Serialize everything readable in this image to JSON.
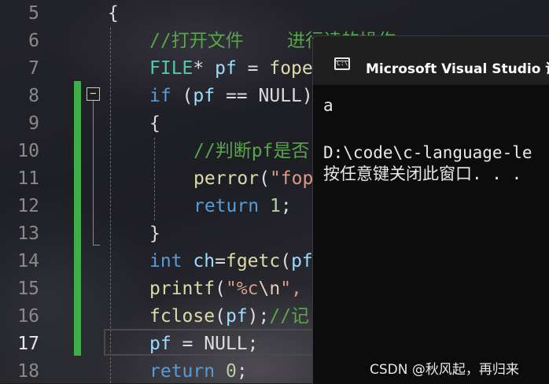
{
  "editor": {
    "line_numbers": [
      "5",
      "6",
      "7",
      "8",
      "9",
      "10",
      "11",
      "12",
      "13",
      "14",
      "15",
      "16",
      "17",
      "18"
    ],
    "lines": [
      {
        "num": "5",
        "parts": [
          {
            "t": "{",
            "c": ""
          }
        ]
      },
      {
        "num": "6",
        "parts": [
          {
            "t": "//打开文件    进行读的操作",
            "c": "cm"
          }
        ]
      },
      {
        "num": "7",
        "parts": [
          {
            "t": "FILE",
            "c": "tp"
          },
          {
            "t": "* ",
            "c": ""
          },
          {
            "t": "pf",
            "c": "id"
          },
          {
            "t": " = ",
            "c": ""
          },
          {
            "t": "fopen",
            "c": "fn"
          }
        ]
      },
      {
        "num": "8",
        "parts": [
          {
            "t": "if",
            "c": "kw"
          },
          {
            "t": " (",
            "c": ""
          },
          {
            "t": "pf",
            "c": "id"
          },
          {
            "t": " == NULL)",
            "c": ""
          }
        ]
      },
      {
        "num": "9",
        "parts": [
          {
            "t": "{",
            "c": ""
          }
        ]
      },
      {
        "num": "10",
        "parts": [
          {
            "t": "//判断pf是否",
            "c": "cm"
          }
        ]
      },
      {
        "num": "11",
        "parts": [
          {
            "t": "perror",
            "c": "fn"
          },
          {
            "t": "(",
            "c": ""
          },
          {
            "t": "\"fopen",
            "c": "str"
          }
        ]
      },
      {
        "num": "12",
        "parts": [
          {
            "t": "return",
            "c": "kw"
          },
          {
            "t": " ",
            "c": ""
          },
          {
            "t": "1",
            "c": "num"
          },
          {
            "t": ";",
            "c": ""
          }
        ]
      },
      {
        "num": "13",
        "parts": [
          {
            "t": "}",
            "c": ""
          }
        ]
      },
      {
        "num": "14",
        "parts": [
          {
            "t": "int",
            "c": "kw"
          },
          {
            "t": " ",
            "c": ""
          },
          {
            "t": "ch",
            "c": "id"
          },
          {
            "t": "=",
            "c": ""
          },
          {
            "t": "fgetc",
            "c": "fn"
          },
          {
            "t": "(",
            "c": ""
          },
          {
            "t": "pf",
            "c": "id"
          }
        ]
      },
      {
        "num": "15",
        "parts": [
          {
            "t": "printf",
            "c": "fn"
          },
          {
            "t": "(",
            "c": ""
          },
          {
            "t": "\"%c",
            "c": "str"
          },
          {
            "t": "\\n",
            "c": "esc"
          },
          {
            "t": "\", ",
            "c": "str"
          }
        ]
      },
      {
        "num": "16",
        "parts": [
          {
            "t": "fclose",
            "c": "fn"
          },
          {
            "t": "(",
            "c": ""
          },
          {
            "t": "pf",
            "c": "id"
          },
          {
            "t": ");",
            "c": ""
          },
          {
            "t": "//记",
            "c": "cm"
          }
        ]
      },
      {
        "num": "17",
        "parts": [
          {
            "t": "pf",
            "c": "id"
          },
          {
            "t": " = NULL;",
            "c": ""
          }
        ]
      },
      {
        "num": "18",
        "parts": [
          {
            "t": "return",
            "c": "kw"
          },
          {
            "t": " ",
            "c": ""
          },
          {
            "t": "0",
            "c": "num"
          },
          {
            "t": ";",
            "c": ""
          }
        ]
      }
    ],
    "current_line": "17",
    "collapse_symbol": "−"
  },
  "console": {
    "title": "Microsoft Visual Studio 调试",
    "icon_glyph": "C:\\",
    "output_lines": [
      "a",
      "",
      "D:\\code\\c-language-le",
      "按任意键关闭此窗口. . ."
    ]
  },
  "watermark": "CSDN @秋风起，再归来"
}
